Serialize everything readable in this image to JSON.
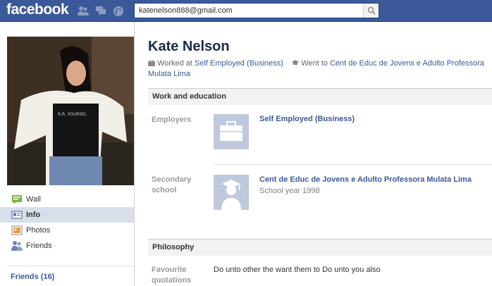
{
  "header": {
    "logo": "facebook",
    "search_value": "katenelson888@gmail.com"
  },
  "sidebar": {
    "items": [
      {
        "label": "Wall",
        "icon": "wall-icon"
      },
      {
        "label": "Info",
        "icon": "info-icon",
        "selected": true
      },
      {
        "label": "Photos",
        "icon": "photos-icon"
      },
      {
        "label": "Friends",
        "icon": "friends-icon"
      }
    ],
    "friends_count_link": "Friends (16)"
  },
  "profile": {
    "name": "Kate Nelson",
    "worked_prefix": "Worked at",
    "worked_link": "Self Employed (Business)",
    "went_prefix": "Went to",
    "went_link": "Cent de Educ de Jovens e Adulto Professora Mulata Lima"
  },
  "work_education": {
    "heading": "Work and education",
    "employers_label": "Employers",
    "employer_name": "Self Employed (Business)",
    "school_label_line1": "Secondary",
    "school_label_line2": "school",
    "school_name": "Cent de Educ de Jovens e Adulto Professora Mulata Lima",
    "school_year": "School year 1998"
  },
  "philosophy": {
    "heading": "Philosophy",
    "quotations_label_line1": "Favourite",
    "quotations_label_line2": "quotations",
    "quotation": "Do unto other the want them to Do unto you also"
  },
  "colors": {
    "brand_blue": "#3b5998",
    "selected_nav_bg": "#d8dfea",
    "thumb_bg": "#bfc8dc"
  }
}
